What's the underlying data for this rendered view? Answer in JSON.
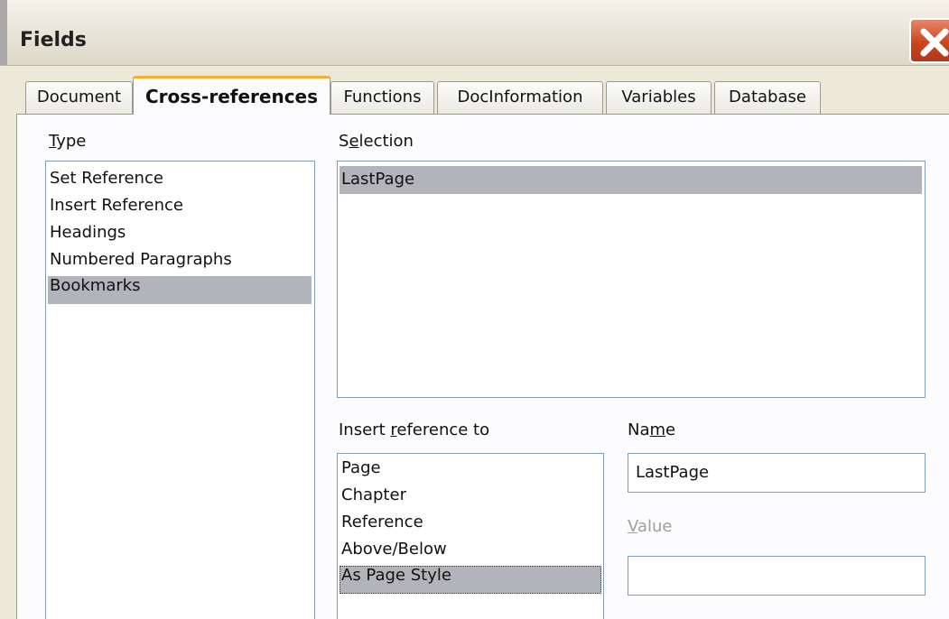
{
  "window": {
    "title": "Fields"
  },
  "tabs": [
    "Document",
    "Cross-references",
    "Functions",
    "DocInformation",
    "Variables",
    "Database"
  ],
  "active_tab": "Cross-references",
  "type": {
    "label_prefix": "",
    "label_mnemonic": "T",
    "label_rest": "ype",
    "items": [
      "Set Reference",
      "Insert Reference",
      "Headings",
      "Numbered Paragraphs",
      "Bookmarks"
    ],
    "selected": "Bookmarks"
  },
  "selection": {
    "label_prefix": "S",
    "label_mnemonic": "e",
    "label_rest": "lection",
    "items": [
      "LastPage"
    ],
    "selected": "LastPage"
  },
  "insert_reference_to": {
    "label_prefix": "Insert ",
    "label_mnemonic": "r",
    "label_rest": "eference to",
    "items": [
      "Page",
      "Chapter",
      "Reference",
      "Above/Below",
      "As Page Style"
    ],
    "selected": "As Page Style"
  },
  "name": {
    "label_prefix": "Na",
    "label_mnemonic": "m",
    "label_rest": "e",
    "value": "LastPage"
  },
  "value_field": {
    "label_prefix": "",
    "label_mnemonic": "V",
    "label_rest": "alue",
    "value": ""
  }
}
